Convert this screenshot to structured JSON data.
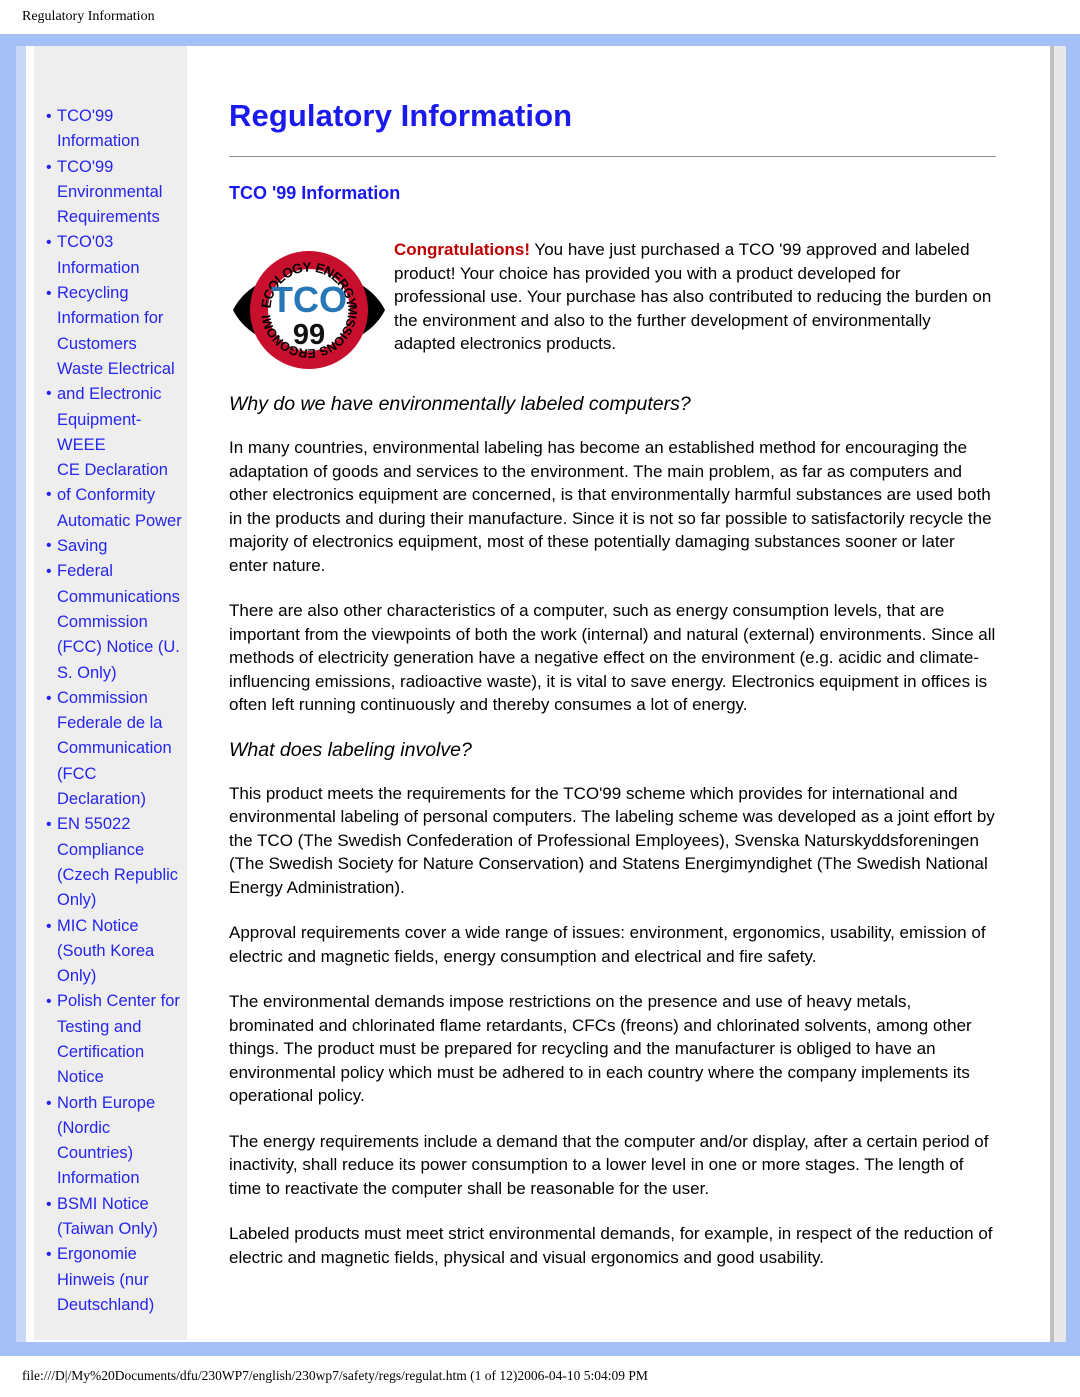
{
  "browser": {
    "header_title": "Regulatory Information",
    "footer_path": "file:///D|/My%20Documents/dfu/230WP7/english/230wp7/safety/regs/regulat.htm (1 of 12)2006-04-10 5:04:09 PM"
  },
  "colors": {
    "frame_blue": "#a4c0f4",
    "link_blue": "#2525ee",
    "heading_blue": "#1a1aee",
    "sidebar_bg": "#eeeeee",
    "congrats_red": "#c00000",
    "logo_red": "#c8102e",
    "logo_blue": "#2878b8"
  },
  "sidebar": {
    "items": [
      {
        "label": "TCO'99 Information",
        "bullet_offset": false
      },
      {
        "label": "TCO'99 Environmental Requirements",
        "bullet_offset": false
      },
      {
        "label": "TCO'03 Information",
        "bullet_offset": false
      },
      {
        "label": "Recycling Information for Customers",
        "bullet_offset": false
      },
      {
        "label": "Waste Electrical and Electronic Equipment- WEEE",
        "bullet_offset": true
      },
      {
        "label": "CE Declaration of Conformity",
        "bullet_offset": true
      },
      {
        "label": "Automatic Power Saving",
        "bullet_offset": true
      },
      {
        "label": "Federal Communications Commission (FCC) Notice (U. S. Only)",
        "bullet_offset": false
      },
      {
        "label": "Commission Federale de la Communication (FCC Declaration)",
        "bullet_offset": false
      },
      {
        "label": "EN 55022 Compliance (Czech Republic Only)",
        "bullet_offset": false
      },
      {
        "label": "MIC Notice (South Korea Only)",
        "bullet_offset": false
      },
      {
        "label": "Polish Center for Testing and Certification Notice",
        "bullet_offset": false
      },
      {
        "label": "North Europe (Nordic Countries) Information",
        "bullet_offset": false
      },
      {
        "label": "BSMI Notice (Taiwan Only)",
        "bullet_offset": false
      },
      {
        "label": "Ergonomie Hinweis (nur Deutschland)",
        "bullet_offset": false
      }
    ]
  },
  "main": {
    "title": "Regulatory Information",
    "section_title": "TCO '99 Information",
    "logo": {
      "top_text": "ECOLOGY ENERGY",
      "bottom_text": "EMISSIONS ERGONOMICS",
      "center_text": "TCO",
      "year_text": "99"
    },
    "congrats_label": "Congratulations!",
    "intro_paragraph": " You have just purchased a TCO '99 approved and labeled product! Your choice has provided you with a product developed for professional use. Your purchase has also contributed to reducing the burden on the environment and also to the further development of environmentally adapted electronics products.",
    "subheading_1": "Why do we have environmentally labeled computers?",
    "paragraph_1": "In many countries, environmental labeling has become an established method for encouraging the adaptation of goods and services to the environment. The main problem, as far as computers and other electronics equipment are concerned, is that environmentally harmful substances are used both in the products and during their manufacture. Since it is not so far possible to satisfactorily recycle the majority of electronics equipment, most of these potentially damaging substances sooner or later enter nature.",
    "paragraph_2": "There are also other characteristics of a computer, such as energy consumption levels, that are important from the viewpoints of both the work (internal) and natural (external) environments. Since all methods of electricity generation have a negative effect on the environment (e.g. acidic and climate-influencing emissions, radioactive waste), it is vital to save energy. Electronics equipment in offices is often left running continuously and thereby consumes a lot of energy.",
    "subheading_2": "What does labeling involve?",
    "paragraph_3": "This product meets the requirements for the TCO'99 scheme which provides for international and environmental labeling of personal computers. The labeling scheme was developed as a joint effort by the TCO (The Swedish Confederation of Professional Employees), Svenska Naturskyddsforeningen (The Swedish Society for Nature Conservation) and Statens Energimyndighet (The Swedish National Energy Administration).",
    "paragraph_4": "Approval requirements cover a wide range of issues: environment, ergonomics, usability, emission of electric and magnetic fields, energy consumption and electrical and fire safety.",
    "paragraph_5": "The environmental demands impose restrictions on the presence and use of heavy metals, brominated and chlorinated flame retardants, CFCs (freons) and chlorinated solvents, among other things. The product must be prepared for recycling and the manufacturer is obliged to have an environmental policy which must be adhered to in each country where the company implements its operational policy.",
    "paragraph_6": "The energy requirements include a demand that the computer and/or display, after a certain period of inactivity, shall reduce its power consumption to a lower level in one or more stages. The length of time to reactivate the computer shall be reasonable for the user.",
    "paragraph_7": "Labeled products must meet strict environmental demands, for example, in respect of the reduction of electric and magnetic fields, physical and visual ergonomics and good usability."
  }
}
